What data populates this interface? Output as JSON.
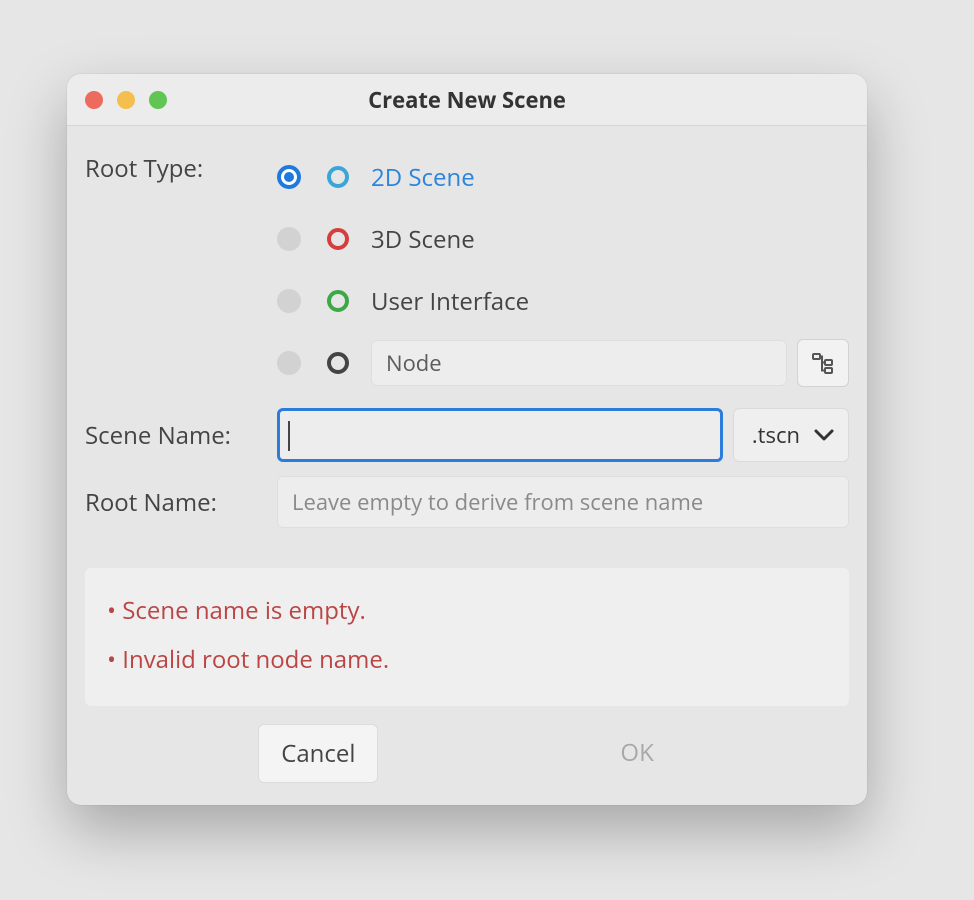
{
  "dialog": {
    "title": "Create New Scene",
    "labels": {
      "root_type": "Root Type:",
      "scene_name": "Scene Name:",
      "root_name": "Root Name:"
    },
    "root_type_options": [
      {
        "id": "2d",
        "label": "2D Scene",
        "selected": true,
        "icon_color": "#3aa6d8"
      },
      {
        "id": "3d",
        "label": "3D Scene",
        "selected": false,
        "icon_color": "#d63e3e"
      },
      {
        "id": "ui",
        "label": "User Interface",
        "selected": false,
        "icon_color": "#3ca846"
      },
      {
        "id": "node",
        "label": "Node",
        "selected": false,
        "icon_color": "#444444",
        "custom_picker": true
      }
    ],
    "scene_name_value": "",
    "extension": ".tscn",
    "root_name_value": "",
    "root_name_placeholder": "Leave empty to derive from scene name",
    "errors": [
      "Scene name is empty.",
      "Invalid root node name."
    ],
    "buttons": {
      "cancel": "Cancel",
      "ok": "OK",
      "ok_enabled": false
    }
  },
  "colors": {
    "accent": "#2c7cdb",
    "error": "#bb4545"
  }
}
